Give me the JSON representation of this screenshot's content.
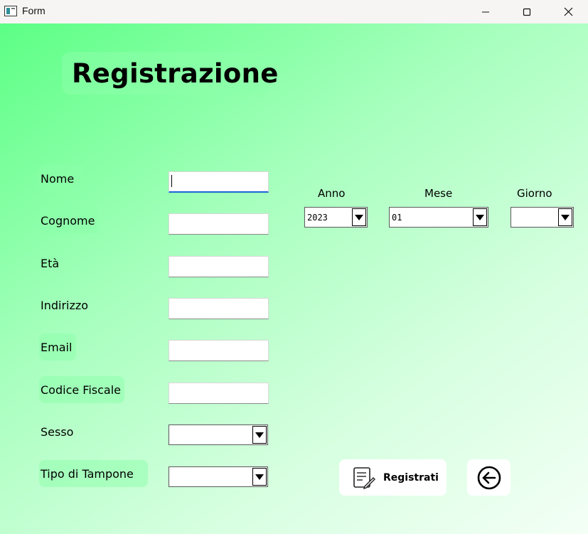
{
  "window": {
    "title": "Form"
  },
  "heading": "Registrazione",
  "fields": [
    {
      "label": "Nome",
      "value": ""
    },
    {
      "label": "Cognome",
      "value": ""
    },
    {
      "label": "Età",
      "value": ""
    },
    {
      "label": "Indirizzo",
      "value": ""
    },
    {
      "label": "Email",
      "value": ""
    },
    {
      "label": "Codice Fiscale",
      "value": ""
    }
  ],
  "selects": {
    "sesso": {
      "label": "Sesso",
      "value": ""
    },
    "tampone": {
      "label": "Tipo di Tampone",
      "value": ""
    }
  },
  "date": {
    "anno": {
      "label": "Anno",
      "value": "2023"
    },
    "mese": {
      "label": "Mese",
      "value": "01"
    },
    "giorno": {
      "label": "Giorno",
      "value": ""
    }
  },
  "buttons": {
    "register_label": "Registrati",
    "register_icon": "document-edit-icon",
    "back_icon": "arrow-left-circle-icon"
  },
  "colors": {
    "background_start": "#5cff85",
    "background_end": "#f4fff6",
    "focus_accent": "#1a66d6"
  }
}
